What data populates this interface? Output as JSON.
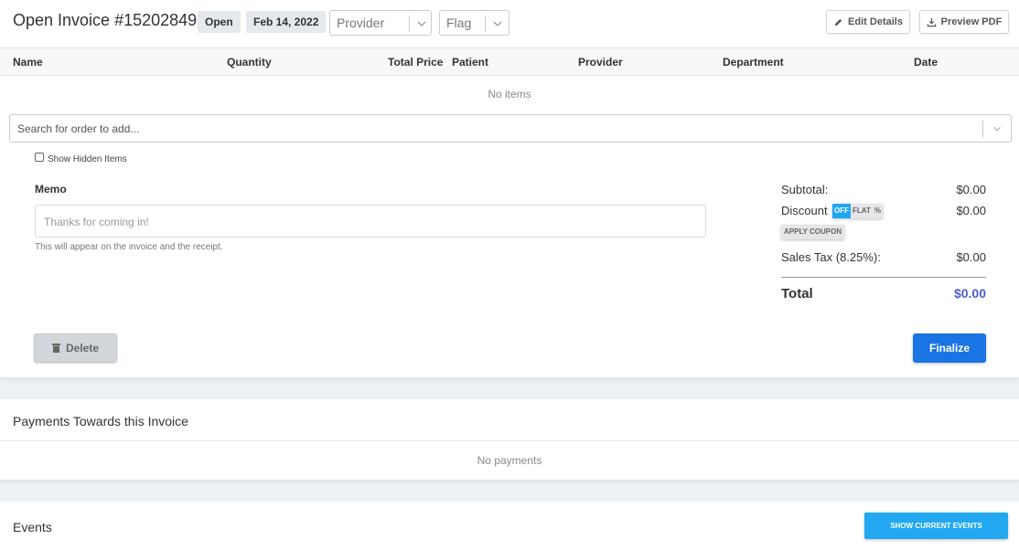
{
  "header": {
    "title": "Open Invoice #15202849",
    "status_badge": "Open",
    "date_badge": "Feb 14, 2022",
    "provider_select": {
      "placeholder": "Provider"
    },
    "flag_select": {
      "placeholder": "Flag"
    },
    "edit_details_label": "Edit Details",
    "preview_pdf_label": "Preview PDF"
  },
  "table": {
    "columns": [
      "Name",
      "Quantity",
      "Total Price",
      "Patient",
      "Provider",
      "Department",
      "Date"
    ],
    "empty_text": "No items"
  },
  "search": {
    "placeholder": "Search for order to add..."
  },
  "show_hidden_label": "Show Hidden Items",
  "memo": {
    "label": "Memo",
    "placeholder": "Thanks for coming in!",
    "help_text": "This will appear on the invoice and the receipt."
  },
  "totals": {
    "subtotal_label": "Subtotal:",
    "subtotal_value": "$0.00",
    "discount_label": "Discount",
    "discount_value": "$0.00",
    "discount_toggle": {
      "off": "OFF",
      "flat": "FLAT",
      "percent": "%"
    },
    "apply_coupon": "APPLY COUPON",
    "tax_label": "Sales Tax (8.25%):",
    "tax_value": "$0.00",
    "total_label": "Total",
    "total_value": "$0.00"
  },
  "actions": {
    "delete_label": "Delete",
    "finalize_label": "Finalize"
  },
  "payments": {
    "title": "Payments Towards this Invoice",
    "empty_text": "No payments"
  },
  "events": {
    "title": "Events",
    "show_current_label": "SHOW CURRENT EVENTS"
  },
  "colors": {
    "primary": "#1b74e4",
    "accent": "#21a8f0",
    "total": "#4a5fd0"
  }
}
